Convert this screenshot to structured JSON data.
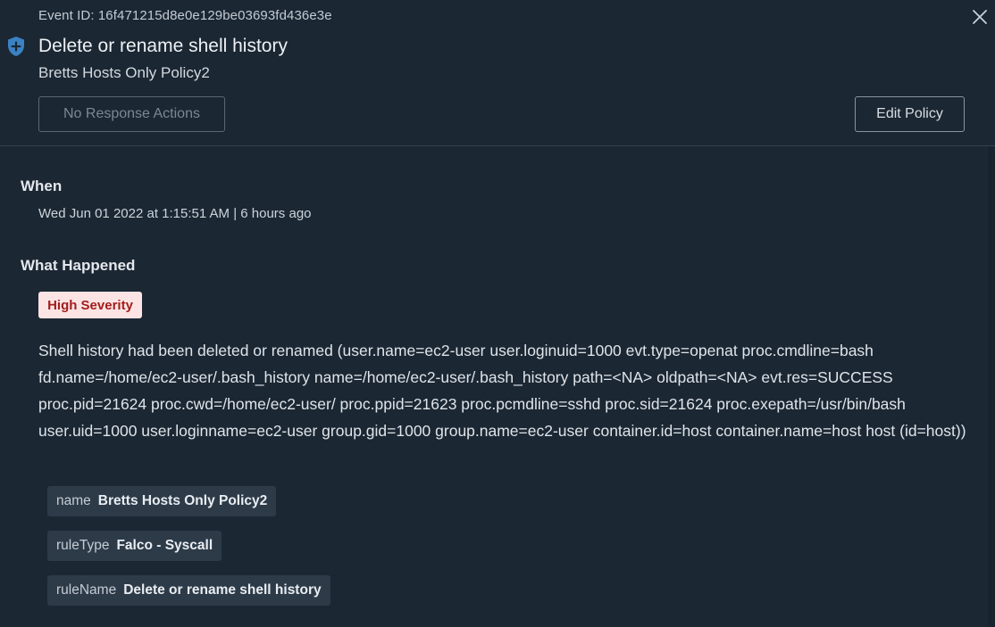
{
  "event_id": "Event ID: 16f471215d8e0e129be03693fd436e3e",
  "title": "Delete or rename shell history",
  "subtitle": "Bretts Hosts Only Policy2",
  "actions": {
    "no_response_label": "No Response Actions",
    "edit_policy_label": "Edit Policy"
  },
  "icons": {
    "header": "shield-plus-icon",
    "close": "close-icon"
  },
  "colors": {
    "background": "#1b2733",
    "badge_bg": "#fde4e4",
    "badge_text": "#a11d1d",
    "shield": "#3b82c4",
    "tag_bg": "#2d3b49"
  },
  "when": {
    "heading": "When",
    "value": "Wed Jun 01 2022 at 1:15:51 AM | 6 hours ago"
  },
  "what_happened": {
    "heading": "What Happened",
    "severity": "High Severity",
    "description": "Shell history had been deleted or renamed (user.name=ec2-user user.loginuid=1000 evt.type=openat proc.cmdline=bash fd.name=/home/ec2-user/.bash_history name=/home/ec2-user/.bash_history path=<NA> oldpath=<NA> evt.res=SUCCESS proc.pid=21624 proc.cwd=/home/ec2-user/ proc.ppid=21623 proc.pcmdline=sshd proc.sid=21624 proc.exepath=/usr/bin/bash user.uid=1000 user.loginname=ec2-user group.gid=1000 group.name=ec2-user container.id=host container.name=host host (id=host))",
    "tags": [
      {
        "key": "name",
        "value": "Bretts Hosts Only Policy2"
      },
      {
        "key": "ruleType",
        "value": "Falco - Syscall"
      },
      {
        "key": "ruleName",
        "value": "Delete or rename shell history"
      }
    ]
  }
}
